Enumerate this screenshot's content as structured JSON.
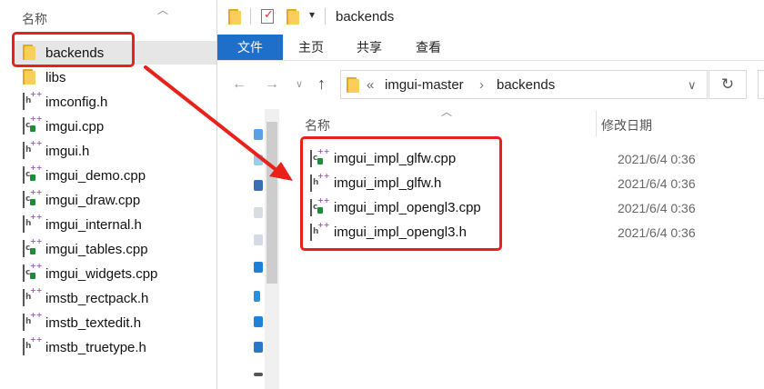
{
  "left_pane": {
    "header": "名称",
    "items": [
      {
        "label": "backends",
        "kind": "folder",
        "selected": true
      },
      {
        "label": "libs",
        "kind": "folder",
        "selected": false
      },
      {
        "label": "imconfig.h",
        "kind": "header"
      },
      {
        "label": "imgui.cpp",
        "kind": "source"
      },
      {
        "label": "imgui.h",
        "kind": "header"
      },
      {
        "label": "imgui_demo.cpp",
        "kind": "source"
      },
      {
        "label": "imgui_draw.cpp",
        "kind": "source"
      },
      {
        "label": "imgui_internal.h",
        "kind": "header"
      },
      {
        "label": "imgui_tables.cpp",
        "kind": "source"
      },
      {
        "label": "imgui_widgets.cpp",
        "kind": "source"
      },
      {
        "label": "imstb_rectpack.h",
        "kind": "header"
      },
      {
        "label": "imstb_textedit.h",
        "kind": "header"
      },
      {
        "label": "imstb_truetype.h",
        "kind": "header"
      }
    ]
  },
  "window": {
    "title": "backends",
    "ribbon_tabs": [
      "文件",
      "主页",
      "共享",
      "查看"
    ],
    "active_tab": "文件",
    "address": {
      "overflow": "«",
      "segments": [
        "imgui-master",
        "backends"
      ],
      "separator": "›"
    }
  },
  "file_list": {
    "col_name": "名称",
    "col_date": "修改日期",
    "files": [
      {
        "name": "imgui_impl_glfw.cpp",
        "kind": "source",
        "date": "2021/6/4 0:36"
      },
      {
        "name": "imgui_impl_glfw.h",
        "kind": "header",
        "date": "2021/6/4 0:36"
      },
      {
        "name": "imgui_impl_opengl3.cpp",
        "kind": "source",
        "date": "2021/6/4 0:36"
      },
      {
        "name": "imgui_impl_opengl3.h",
        "kind": "header",
        "date": "2021/6/4 0:36"
      }
    ]
  },
  "icons": {
    "back": "back-arrow-icon",
    "forward": "forward-arrow-icon",
    "recent": "recent-locations-icon",
    "up": "up-arrow-icon",
    "refresh": "refresh-icon",
    "dropdown": "dropdown-chevron-icon"
  },
  "colors": {
    "accent": "#1e6fc9",
    "annotation_red": "#e8211b",
    "folder": "#f8cf5b",
    "selection": "#e6e6e6"
  }
}
